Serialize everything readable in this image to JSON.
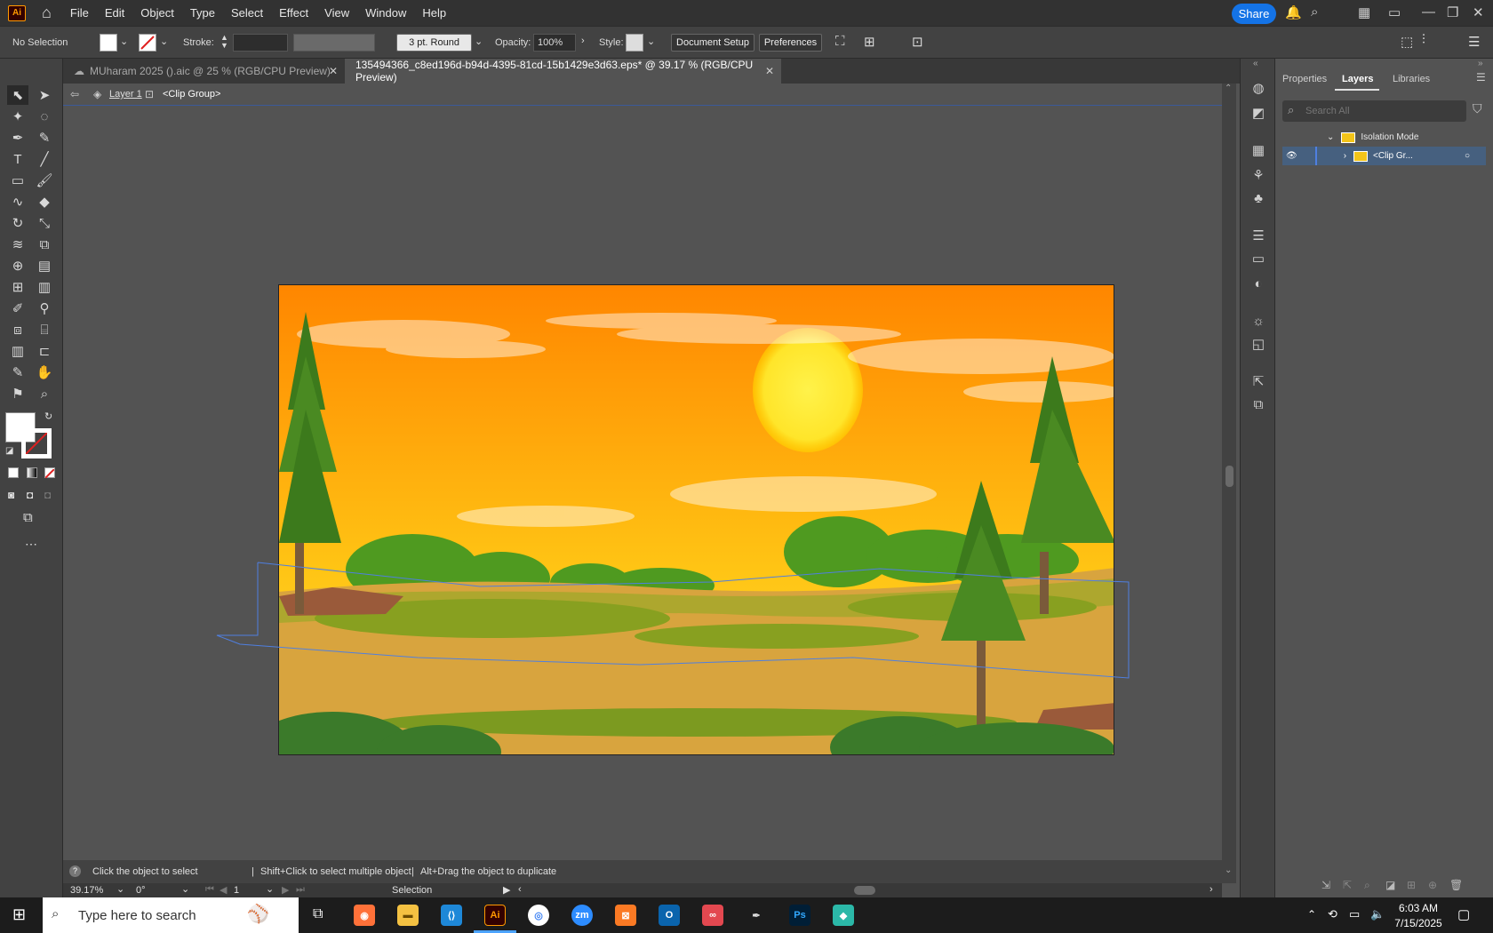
{
  "menubar": {
    "logo": "Ai",
    "items": [
      "File",
      "Edit",
      "Object",
      "Type",
      "Select",
      "Effect",
      "View",
      "Window",
      "Help"
    ],
    "share_label": "Share"
  },
  "control": {
    "selection": "No Selection",
    "stroke_label": "Stroke:",
    "brush": "3 pt. Round",
    "opacity_label": "Opacity:",
    "opacity_value": "100%",
    "style_label": "Style:",
    "document_setup": "Document Setup",
    "preferences": "Preferences"
  },
  "tabs": [
    {
      "label": "MUharam 2025 ().aic @ 25 % (RGB/CPU Preview)",
      "active": false
    },
    {
      "label": "135494366_c8ed196d-b94d-4395-81cd-15b1429e3d63.eps* @ 39.17 % (RGB/CPU Preview)",
      "active": true
    }
  ],
  "breadcrumb": {
    "layer": "Layer 1",
    "group": "<Clip Group>"
  },
  "status": {
    "hint_click": "Click the object to select",
    "hint_shift": "Shift+Click to select multiple object",
    "hint_alt": "Alt+Drag the object to duplicate",
    "zoom": "39.17%",
    "rotation": "0°",
    "artboard": "1",
    "tool": "Selection"
  },
  "panel": {
    "tabs": [
      "Properties",
      "Layers",
      "Libraries"
    ],
    "active_tab": "Layers",
    "search_placeholder": "Search All",
    "rows": [
      {
        "label": "Isolation Mode"
      },
      {
        "label": "<Clip Gr..."
      }
    ]
  },
  "taskbar": {
    "search_placeholder": "Type here to search",
    "time": "6:03 AM",
    "date": "7/15/2025"
  },
  "colors": {
    "accent": "#1473e6",
    "sky_top": "#ff8a00",
    "sky_bottom": "#ffd21a",
    "ground": "#d8a43e",
    "grass": "#88a020"
  }
}
